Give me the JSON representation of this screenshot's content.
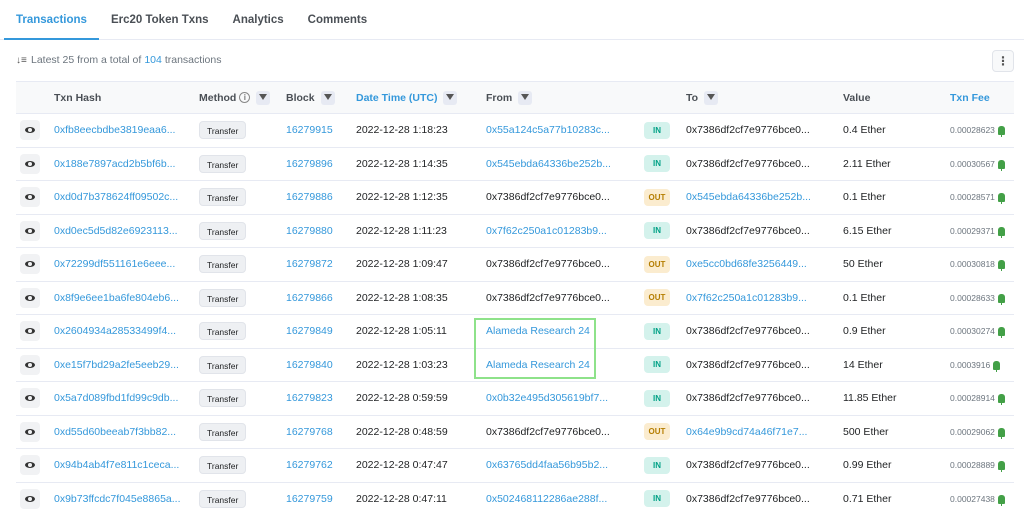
{
  "tabs": [
    "Transactions",
    "Erc20 Token Txns",
    "Analytics",
    "Comments"
  ],
  "summary": {
    "prefix": "Latest 25 from a total of",
    "count": "104",
    "suffix": "transactions"
  },
  "more_button": "⋮",
  "columns": {
    "txn_hash": "Txn Hash",
    "method": "Method",
    "block": "Block",
    "date_time": "Date Time (UTC)",
    "from": "From",
    "to": "To",
    "value": "Value",
    "txn_fee": "Txn Fee"
  },
  "rows": [
    {
      "hash": "0xfb8eecbdbe3819eaa6...",
      "method": "Transfer",
      "block": "16279915",
      "time": "2022-12-28 1:18:23",
      "from": "0x55a124c5a77b10283c...",
      "from_link": true,
      "dir": "IN",
      "to": "0x7386df2cf7e9776bce0...",
      "to_link": false,
      "value": "0.4 Ether",
      "fee": "0.00028623"
    },
    {
      "hash": "0x188e7897acd2b5bf6b...",
      "method": "Transfer",
      "block": "16279896",
      "time": "2022-12-28 1:14:35",
      "from": "0x545ebda64336be252b...",
      "from_link": true,
      "dir": "IN",
      "to": "0x7386df2cf7e9776bce0...",
      "to_link": false,
      "value": "2.11 Ether",
      "fee": "0.00030567"
    },
    {
      "hash": "0xd0d7b378624ff09502c...",
      "method": "Transfer",
      "block": "16279886",
      "time": "2022-12-28 1:12:35",
      "from": "0x7386df2cf7e9776bce0...",
      "from_link": false,
      "dir": "OUT",
      "to": "0x545ebda64336be252b...",
      "to_link": true,
      "value": "0.1 Ether",
      "fee": "0.00028571"
    },
    {
      "hash": "0xd0ec5d5d82e6923113...",
      "method": "Transfer",
      "block": "16279880",
      "time": "2022-12-28 1:11:23",
      "from": "0x7f62c250a1c01283b9...",
      "from_link": true,
      "dir": "IN",
      "to": "0x7386df2cf7e9776bce0...",
      "to_link": false,
      "value": "6.15 Ether",
      "fee": "0.00029371"
    },
    {
      "hash": "0x72299df551161e6eee...",
      "method": "Transfer",
      "block": "16279872",
      "time": "2022-12-28 1:09:47",
      "from": "0x7386df2cf7e9776bce0...",
      "from_link": false,
      "dir": "OUT",
      "to": "0xe5cc0bd68fe3256449...",
      "to_link": true,
      "value": "50 Ether",
      "fee": "0.00030818"
    },
    {
      "hash": "0x8f9e6ee1ba6fe804eb6...",
      "method": "Transfer",
      "block": "16279866",
      "time": "2022-12-28 1:08:35",
      "from": "0x7386df2cf7e9776bce0...",
      "from_link": false,
      "dir": "OUT",
      "to": "0x7f62c250a1c01283b9...",
      "to_link": true,
      "value": "0.1 Ether",
      "fee": "0.00028633"
    },
    {
      "hash": "0x2604934a28533499f4...",
      "method": "Transfer",
      "block": "16279849",
      "time": "2022-12-28 1:05:11",
      "from": "Alameda Research 24",
      "from_link": true,
      "dir": "IN",
      "to": "0x7386df2cf7e9776bce0...",
      "to_link": false,
      "value": "0.9 Ether",
      "fee": "0.00030274"
    },
    {
      "hash": "0xe15f7bd29a2fe5eeb29...",
      "method": "Transfer",
      "block": "16279840",
      "time": "2022-12-28 1:03:23",
      "from": "Alameda Research 24",
      "from_link": true,
      "dir": "IN",
      "to": "0x7386df2cf7e9776bce0...",
      "to_link": false,
      "value": "14 Ether",
      "fee": "0.0003916"
    },
    {
      "hash": "0x5a7d089fbd1fd99c9db...",
      "method": "Transfer",
      "block": "16279823",
      "time": "2022-12-28 0:59:59",
      "from": "0x0b32e495d305619bf7...",
      "from_link": true,
      "dir": "IN",
      "to": "0x7386df2cf7e9776bce0...",
      "to_link": false,
      "value": "11.85 Ether",
      "fee": "0.00028914"
    },
    {
      "hash": "0xd55d60beeab7f3bb82...",
      "method": "Transfer",
      "block": "16279768",
      "time": "2022-12-28 0:48:59",
      "from": "0x7386df2cf7e9776bce0...",
      "from_link": false,
      "dir": "OUT",
      "to": "0x64e9b9cd74a46f71e7...",
      "to_link": true,
      "value": "500 Ether",
      "fee": "0.00029062"
    },
    {
      "hash": "0x94b4ab4f7e811c1ceca...",
      "method": "Transfer",
      "block": "16279762",
      "time": "2022-12-28 0:47:47",
      "from": "0x63765dd4faa56b95b2...",
      "from_link": true,
      "dir": "IN",
      "to": "0x7386df2cf7e9776bce0...",
      "to_link": false,
      "value": "0.99 Ether",
      "fee": "0.00028889"
    },
    {
      "hash": "0x9b73ffcdc7f045e8865a...",
      "method": "Transfer",
      "block": "16279759",
      "time": "2022-12-28 0:47:11",
      "from": "0x502468112286ae288f...",
      "from_link": true,
      "dir": "IN",
      "to": "0x7386df2cf7e9776bce0...",
      "to_link": false,
      "value": "0.71 Ether",
      "fee": "0.00027438"
    }
  ]
}
